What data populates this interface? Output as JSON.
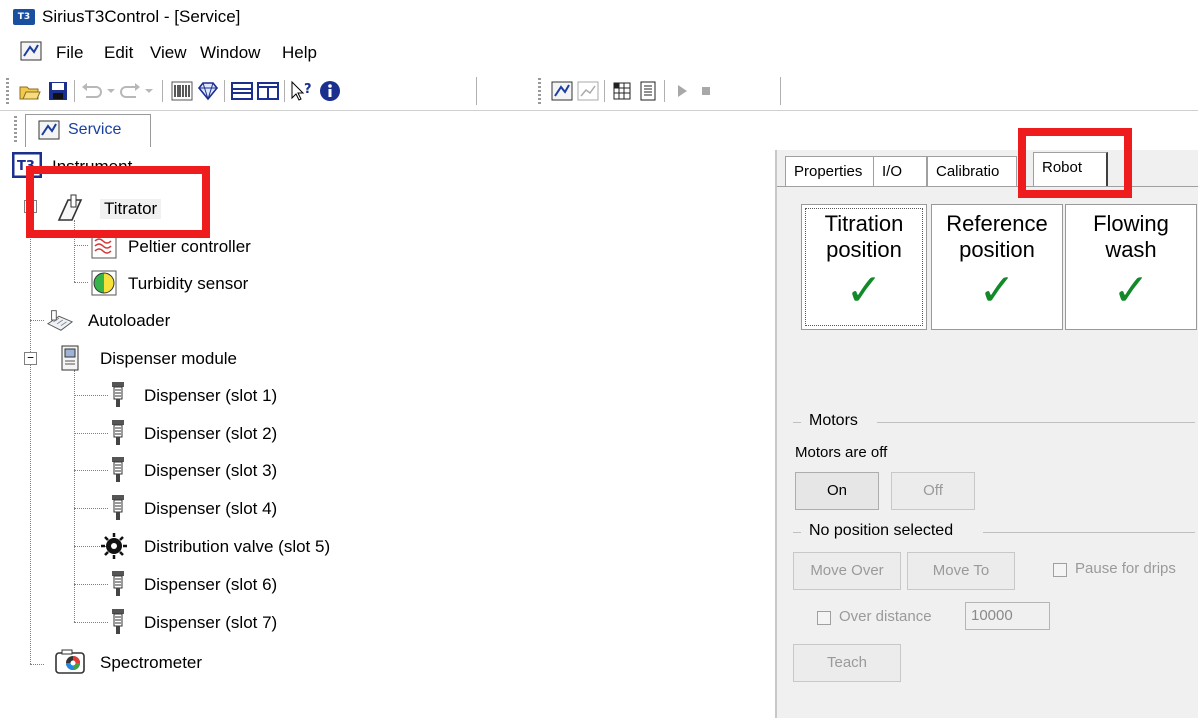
{
  "window": {
    "app_icon_text": "T3",
    "title": "SiriusT3Control - [Service]"
  },
  "menu": {
    "items": [
      "File",
      "Edit",
      "View",
      "Window",
      "Help"
    ]
  },
  "document_tab": {
    "label": "Service"
  },
  "tree": {
    "root": "Instrument",
    "nodes": [
      {
        "label": "Titrator",
        "icon": "titrator-icon"
      },
      {
        "label": "Peltier controller",
        "icon": "peltier-icon"
      },
      {
        "label": "Turbidity sensor",
        "icon": "turbidity-icon"
      },
      {
        "label": "Autoloader",
        "icon": "autoloader-icon"
      },
      {
        "label": "Dispenser module",
        "icon": "dispenser-module-icon"
      },
      {
        "label": "Dispenser (slot 1)",
        "icon": "dispenser-icon"
      },
      {
        "label": "Dispenser (slot 2)",
        "icon": "dispenser-icon"
      },
      {
        "label": "Dispenser (slot 3)",
        "icon": "dispenser-icon"
      },
      {
        "label": "Dispenser (slot 4)",
        "icon": "dispenser-icon"
      },
      {
        "label": "Distribution valve (slot 5)",
        "icon": "valve-icon"
      },
      {
        "label": "Dispenser (slot 6)",
        "icon": "dispenser-icon"
      },
      {
        "label": "Dispenser (slot 7)",
        "icon": "dispenser-icon"
      },
      {
        "label": "Spectrometer",
        "icon": "spectrometer-icon"
      }
    ]
  },
  "panel": {
    "tabs": [
      "Properties",
      "I/O",
      "Calibratio",
      "Robot"
    ],
    "active_tab": "Robot",
    "positions": [
      {
        "line1": "Titration",
        "line2": "position",
        "checked": true
      },
      {
        "line1": "Reference",
        "line2": "position",
        "checked": true
      },
      {
        "line1": "Flowing",
        "line2": "wash",
        "checked": true
      }
    ],
    "check_mark": "✓",
    "motors": {
      "group_title": "Motors",
      "status": "Motors are off",
      "on_label": "On",
      "off_label": "Off"
    },
    "position_group": {
      "title": "No position selected",
      "move_over_label": "Move Over",
      "move_to_label": "Move To",
      "pause_label": "Pause for drips",
      "over_distance_label": "Over distance",
      "over_distance_value": "10000",
      "teach_label": "Teach"
    }
  },
  "colors": {
    "highlight": "#ee1c1c",
    "check": "#138a2a",
    "tab_text": "#1a3fa0"
  }
}
